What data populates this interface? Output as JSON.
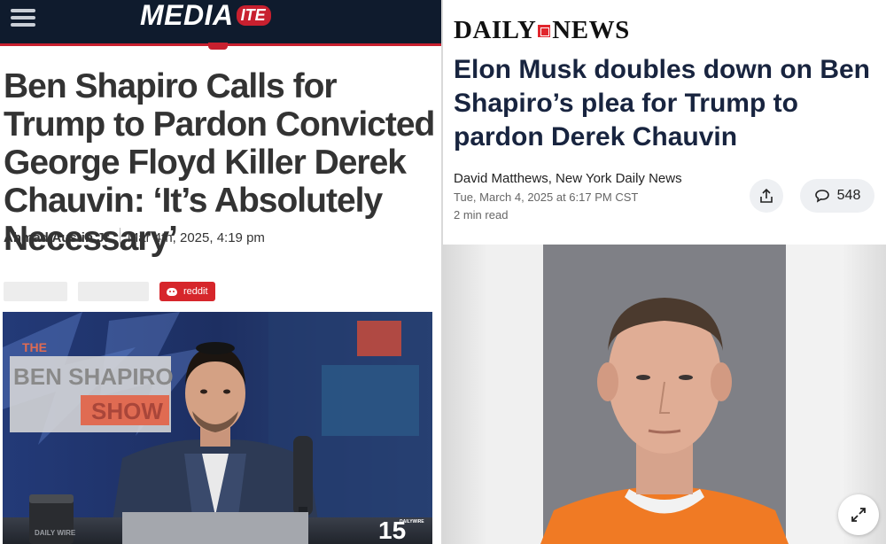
{
  "left": {
    "brand": {
      "logo_main": "MEDIA",
      "logo_pill": "ITE"
    },
    "headline": "Ben Shapiro Calls for Trump to Pardon Convicted George Floyd Killer Derek Chauvin: ‘It’s Absolutely Necessary’",
    "author": "Ahmad Austin Jr.",
    "date": "Mar 4th, 2025, 4:19 pm",
    "share": {
      "reddit_label": "reddit"
    },
    "video": {
      "show_line1": "THE",
      "show_line2": "BEN SHAPIRO",
      "show_line3": "SHOW",
      "mug_text": "DAILY WIRE",
      "watermark": "15",
      "watermark_sub": "DAILYWIRE"
    },
    "colors": {
      "header_bg": "#0f1b2d",
      "accent": "#c8202f",
      "headline": "#333333"
    }
  },
  "right": {
    "brand": {
      "logo_left": "DAILY",
      "logo_right": "NEWS"
    },
    "headline": "Elon Musk doubles down on Ben Shapiro’s plea for Trump to pardon Derek Chauvin",
    "author": "David Matthews, New York Daily News",
    "date": "Tue, March 4, 2025 at 6:17 PM CST",
    "read_time": "2 min read",
    "comments_count": "548",
    "icons": {
      "share": "share-icon",
      "comment": "comment-icon",
      "expand": "expand-icon"
    },
    "colors": {
      "headline": "#18243f",
      "logo_box": "#e1262d",
      "jumpsuit": "#f07a24"
    }
  }
}
